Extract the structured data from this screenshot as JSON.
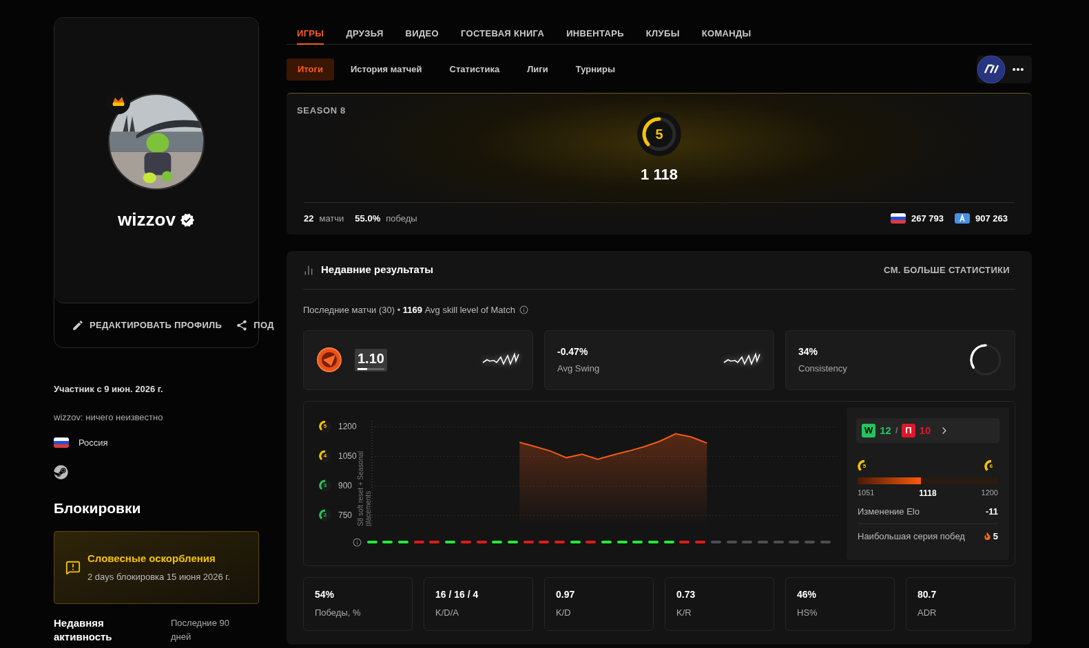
{
  "profile": {
    "username": "wizzov",
    "verified": true,
    "actions": [
      {
        "kind": "edit",
        "label": "РЕДАКТИРОВАТЬ ПРОФИЛЬ"
      },
      {
        "kind": "share",
        "label": "ПОД"
      }
    ],
    "member_since": "Участник с 9 июн. 2026 г.",
    "bio": "wizzov: ничего неизвестно",
    "country": "Россия"
  },
  "bans": {
    "title": "Блокировки",
    "items": [
      {
        "title": "Словесные оскорбления",
        "description": "2 days блокировка 15 июня 2026 г."
      }
    ]
  },
  "activity": {
    "label": "Недавняя активность",
    "value": "Последние 90 дней"
  },
  "nav_tabs": [
    {
      "label": "ИГРЫ",
      "selected": true
    },
    {
      "label": "ДРУЗЬЯ",
      "selected": false
    },
    {
      "label": "ВИДЕО",
      "selected": false
    },
    {
      "label": "ГОСТЕВАЯ КНИГА",
      "selected": false
    },
    {
      "label": "ИНВЕНТАРЬ",
      "selected": false
    },
    {
      "label": "КЛУБЫ",
      "selected": false
    },
    {
      "label": "КОМАНДЫ",
      "selected": false
    }
  ],
  "sub_tabs": [
    {
      "label": "Итоги",
      "selected": true
    },
    {
      "label": "История матчей",
      "selected": false
    },
    {
      "label": "Статистика",
      "selected": false
    },
    {
      "label": "Лиги",
      "selected": false
    },
    {
      "label": "Турниры",
      "selected": false
    }
  ],
  "season": {
    "title": "SEASON 8",
    "level": "5",
    "elo": "1 118",
    "matches": "22",
    "matches_label": "матчи",
    "winrate": "55.0%",
    "winrate_label": "победы",
    "rankings": [
      {
        "kind": "country",
        "value": "267 793"
      },
      {
        "kind": "region",
        "value": "907 263"
      }
    ]
  },
  "recent": {
    "title": "Недавние результаты",
    "more": "СМ. БОЛЬШЕ СТАТИСТИКИ",
    "summary": "Последние матчи (30) • **1169** Avg skill level of Match",
    "cards": [
      {
        "kind": "rating",
        "value": "1.10",
        "level": 0.35
      },
      {
        "kind": "swing",
        "value": "-0.47%",
        "label": "Avg Swing"
      },
      {
        "kind": "ring",
        "value": "34%",
        "label": "Consistency",
        "level": 0.34
      }
    ],
    "chart": {
      "level_badges": [
        {
          "text": "5",
          "color": "#f5c400"
        },
        {
          "text": "4",
          "color": "#f5c400"
        },
        {
          "text": "3",
          "color": "#22c55e"
        },
        {
          "text": "2",
          "color": "#22c55e"
        }
      ],
      "annotation": "S8 soft reset + Seasonal placements",
      "chart_data": {
        "type": "area",
        "categories": [
          null,
          null,
          null,
          null,
          null,
          null,
          null,
          null,
          null,
          null,
          null,
          null,
          null,
          null,
          null,
          null,
          null,
          null,
          null,
          null,
          null,
          null,
          null,
          null,
          null,
          null,
          null,
          null,
          null,
          null
        ],
        "grid": true,
        "ylim": [
          700,
          1230
        ],
        "yticks": [
          750,
          900,
          1050,
          1200
        ],
        "series": [
          {
            "color": "#f35a16",
            "values": [
              null,
              null,
              null,
              null,
              null,
              null,
              null,
              null,
              null,
              1122,
              1100,
              1077,
              1044,
              1062,
              1036,
              1058,
              1078,
              1100,
              1128,
              1165,
              1149,
              1118,
              null,
              null,
              null,
              null,
              null,
              null,
              null,
              null
            ]
          }
        ]
      },
      "results": [
        {
          "kind": "win"
        },
        {
          "kind": "win"
        },
        {
          "kind": "win"
        },
        {
          "kind": "loss"
        },
        {
          "kind": "loss"
        },
        {
          "kind": "win"
        },
        {
          "kind": "loss"
        },
        {
          "kind": "loss"
        },
        {
          "kind": "win"
        },
        {
          "kind": "win"
        },
        {
          "kind": "loss"
        },
        {
          "kind": "loss"
        },
        {
          "kind": "loss"
        },
        {
          "kind": "win"
        },
        {
          "kind": "loss"
        },
        {
          "kind": "win"
        },
        {
          "kind": "win"
        },
        {
          "kind": "win"
        },
        {
          "kind": "win"
        },
        {
          "kind": "win"
        },
        {
          "kind": "loss"
        },
        {
          "kind": "loss"
        },
        {
          "kind": "none"
        },
        {
          "kind": "none"
        },
        {
          "kind": "none"
        },
        {
          "kind": "none"
        },
        {
          "kind": "none"
        },
        {
          "kind": "none"
        },
        {
          "kind": "none"
        },
        {
          "kind": "none"
        }
      ]
    },
    "record": {
      "wins_label": "W",
      "wins": "12",
      "separator": "/",
      "losses_label": "П",
      "losses": "10",
      "range_from_level": "5",
      "range_to_level": "6",
      "range_from": "1051",
      "current": "1118",
      "range_to": "1200",
      "level": 0.45,
      "rows": [
        {
          "label": "Изменение Elo",
          "value": "-11",
          "fire": false
        },
        {
          "label": "Наибольшая серия побед",
          "value": "5",
          "fire": true
        }
      ]
    },
    "stats": [
      {
        "value": "54%",
        "label": "Победы, %"
      },
      {
        "value": "16 / 16 / 4",
        "label": "K/D/A"
      },
      {
        "value": "0.97",
        "label": "K/D"
      },
      {
        "value": "0.73",
        "label": "K/R"
      },
      {
        "value": "46%",
        "label": "HS%"
      },
      {
        "value": "80.7",
        "label": "ADR"
      }
    ]
  }
}
